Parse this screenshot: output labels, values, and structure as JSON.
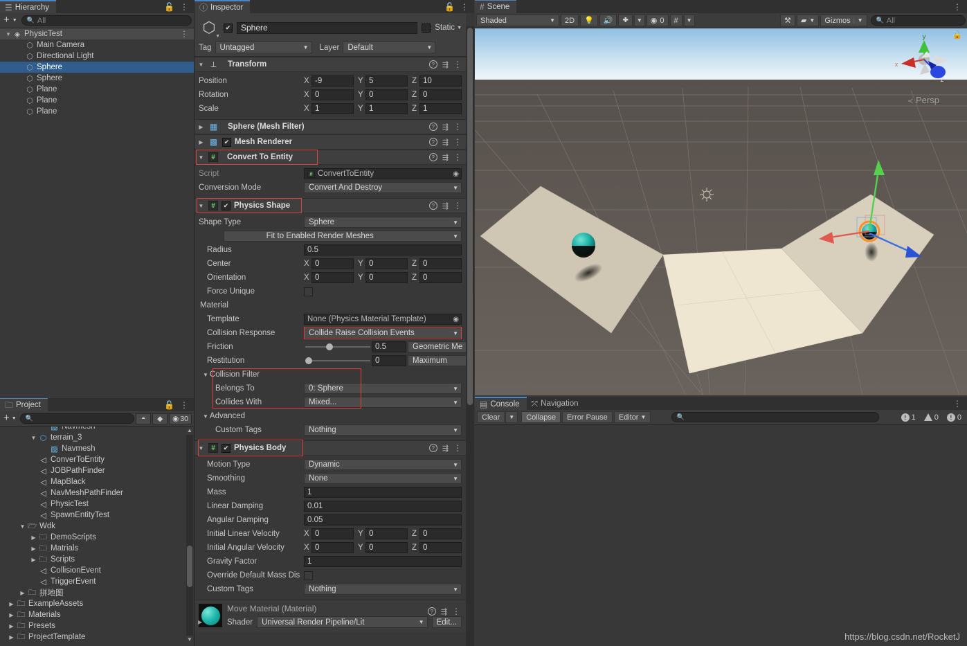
{
  "hierarchy": {
    "tab": "Hierarchy",
    "search_placeholder": "All",
    "add_label": "+",
    "items": [
      {
        "label": "PhysicTest",
        "depth": 0,
        "icon": "scene-icon",
        "expanded": true,
        "selected": false
      },
      {
        "label": "Main Camera",
        "depth": 1,
        "icon": "gameobject-icon",
        "selected": false
      },
      {
        "label": "Directional Light",
        "depth": 1,
        "icon": "gameobject-icon",
        "selected": false
      },
      {
        "label": "Sphere",
        "depth": 1,
        "icon": "gameobject-icon",
        "selected": true
      },
      {
        "label": "Sphere",
        "depth": 1,
        "icon": "gameobject-icon",
        "selected": false
      },
      {
        "label": "Plane",
        "depth": 1,
        "icon": "gameobject-icon",
        "selected": false
      },
      {
        "label": "Plane",
        "depth": 1,
        "icon": "gameobject-icon",
        "selected": false
      },
      {
        "label": "Plane",
        "depth": 1,
        "icon": "gameobject-icon",
        "selected": false
      }
    ]
  },
  "project": {
    "tab": "Project",
    "search_placeholder": "",
    "count_label": "30",
    "items": [
      {
        "label": "Navmesh",
        "depth": 3,
        "icon": "navmesh-icon",
        "clipped": true
      },
      {
        "label": "terrain_3",
        "depth": 2,
        "icon": "prefab-icon",
        "expanded": true
      },
      {
        "label": "Navmesh",
        "depth": 3,
        "icon": "navmesh-icon"
      },
      {
        "label": "ConverToEntity",
        "depth": 2,
        "icon": "script-icon"
      },
      {
        "label": "JOBPathFinder",
        "depth": 2,
        "icon": "script-icon"
      },
      {
        "label": "MapBlack",
        "depth": 2,
        "icon": "script-icon"
      },
      {
        "label": "NavMeshPathFinder",
        "depth": 2,
        "icon": "script-icon"
      },
      {
        "label": "PhysicTest",
        "depth": 2,
        "icon": "script-icon"
      },
      {
        "label": "SpawnEntityTest",
        "depth": 2,
        "icon": "script-icon"
      },
      {
        "label": "Wdk",
        "depth": 1,
        "icon": "folder-open-icon",
        "expanded": true
      },
      {
        "label": "DemoScripts",
        "depth": 2,
        "icon": "folder-icon",
        "collapsed": true
      },
      {
        "label": "Matrials",
        "depth": 2,
        "icon": "folder-icon",
        "collapsed": true
      },
      {
        "label": "Scripts",
        "depth": 2,
        "icon": "folder-icon",
        "collapsed": true
      },
      {
        "label": "CollisionEvent",
        "depth": 2,
        "icon": "script-icon"
      },
      {
        "label": "TriggerEvent",
        "depth": 2,
        "icon": "script-icon"
      },
      {
        "label": "拼地图",
        "depth": 1,
        "icon": "folder-icon",
        "collapsed": true
      },
      {
        "label": "ExampleAssets",
        "depth": 0,
        "icon": "folder-icon",
        "collapsed": true
      },
      {
        "label": "Materials",
        "depth": 0,
        "icon": "folder-icon",
        "collapsed": true
      },
      {
        "label": "Presets",
        "depth": 0,
        "icon": "folder-icon",
        "collapsed": true
      },
      {
        "label": "ProjectTemplate",
        "depth": 0,
        "icon": "folder-icon",
        "collapsed": true
      }
    ]
  },
  "inspector": {
    "tab": "Inspector",
    "object_name": "Sphere",
    "enabled": true,
    "static_label": "Static",
    "tag_label": "Tag",
    "tag_value": "Untagged",
    "layer_label": "Layer",
    "layer_value": "Default",
    "transform": {
      "title": "Transform",
      "position_label": "Position",
      "position": {
        "x": "-9",
        "y": "5",
        "z": "10"
      },
      "rotation_label": "Rotation",
      "rotation": {
        "x": "0",
        "y": "0",
        "z": "0"
      },
      "scale_label": "Scale",
      "scale": {
        "x": "1",
        "y": "1",
        "z": "1"
      }
    },
    "mesh_filter": {
      "title": "Sphere (Mesh Filter)"
    },
    "mesh_renderer": {
      "title": "Mesh Renderer",
      "enabled": true
    },
    "convert_to_entity": {
      "title": "Convert To Entity",
      "script_label": "Script",
      "script_value": "ConvertToEntity",
      "conversion_mode_label": "Conversion Mode",
      "conversion_mode_value": "Convert And Destroy"
    },
    "physics_shape": {
      "title": "Physics Shape",
      "enabled": true,
      "shape_type_label": "Shape Type",
      "shape_type_value": "Sphere",
      "fit_button": "Fit to Enabled Render Meshes",
      "radius_label": "Radius",
      "radius_value": "0.5",
      "center_label": "Center",
      "center": {
        "x": "0",
        "y": "0",
        "z": "0"
      },
      "orientation_label": "Orientation",
      "orientation": {
        "x": "0",
        "y": "0",
        "z": "0"
      },
      "force_unique_label": "Force Unique",
      "force_unique_value": false,
      "material_label": "Material",
      "template_label": "Template",
      "template_value": "None (Physics Material Template)",
      "collision_response_label": "Collision Response",
      "collision_response_value": "Collide Raise Collision Events",
      "friction_label": "Friction",
      "friction_value": "0.5",
      "friction_combine": "Geometric Me",
      "restitution_label": "Restitution",
      "restitution_value": "0",
      "restitution_combine": "Maximum",
      "collision_filter_label": "Collision Filter",
      "belongs_to_label": "Belongs To",
      "belongs_to_value": "0: Sphere",
      "collides_with_label": "Collides With",
      "collides_with_value": "Mixed...",
      "advanced_label": "Advanced",
      "custom_tags_label": "Custom Tags",
      "custom_tags_value": "Nothing"
    },
    "physics_body": {
      "title": "Physics Body",
      "enabled": true,
      "motion_type_label": "Motion Type",
      "motion_type_value": "Dynamic",
      "smoothing_label": "Smoothing",
      "smoothing_value": "None",
      "mass_label": "Mass",
      "mass_value": "1",
      "linear_damping_label": "Linear Damping",
      "linear_damping_value": "0.01",
      "angular_damping_label": "Angular Damping",
      "angular_damping_value": "0.05",
      "initial_linear_velocity_label": "Initial Linear Velocity",
      "initial_linear_velocity": {
        "x": "0",
        "y": "0",
        "z": "0"
      },
      "initial_angular_velocity_label": "Initial Angular Velocity",
      "initial_angular_velocity": {
        "x": "0",
        "y": "0",
        "z": "0"
      },
      "gravity_factor_label": "Gravity Factor",
      "gravity_factor_value": "1",
      "override_mass_label": "Override Default Mass Dis",
      "override_mass_value": false,
      "custom_tags_label": "Custom Tags",
      "custom_tags_value": "Nothing"
    },
    "material_asset": {
      "title": "Move Material (Material)",
      "shader_label": "Shader",
      "shader_value": "Universal Render Pipeline/Lit",
      "edit_label": "Edit..."
    }
  },
  "scene": {
    "tab": "Scene",
    "shading_mode": "Shaded",
    "mode_2d": "2D",
    "audio_count": "0",
    "gizmos_label": "Gizmos",
    "search_placeholder": "All",
    "perspective_label": "Persp",
    "gizmo_axes": {
      "x": "x",
      "y": "y",
      "z": "z"
    },
    "colors": {
      "axis_x": "#cf2b2b",
      "axis_y": "#47c647",
      "axis_z": "#2a55d8",
      "sky_top": "#9fc8e8",
      "sky_horizon": "#e8f2f8",
      "ground": "#5e5753",
      "plane": "#d8cfbd",
      "plane_light": "#eee6d2",
      "sphere": "#1fb8ab"
    }
  },
  "console": {
    "tab": "Console",
    "nav_tab": "Navigation",
    "clear_label": "Clear",
    "collapse_label": "Collapse",
    "error_pause_label": "Error Pause",
    "editor_label": "Editor",
    "search_placeholder": "",
    "error_count": "1",
    "warning_count": "0",
    "info_count": "0"
  },
  "watermark": "https://blog.csdn.net/RocketJ"
}
